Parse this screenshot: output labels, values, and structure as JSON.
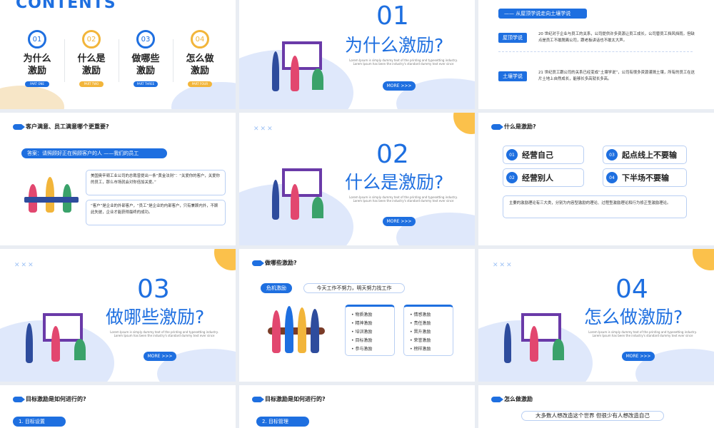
{
  "s1": {
    "title": "CONTENTS",
    "items": [
      {
        "num": "01",
        "l1": "为什么",
        "l2": "激励",
        "tag": "PART ONE",
        "color": "#1e6fe0"
      },
      {
        "num": "02",
        "l1": "什么是",
        "l2": "激励",
        "tag": "PART TWO",
        "color": "#f2b53a"
      },
      {
        "num": "03",
        "l1": "做哪些",
        "l2": "激励",
        "tag": "PART THREE",
        "color": "#1e6fe0"
      },
      {
        "num": "04",
        "l1": "怎么做",
        "l2": "激励",
        "tag": "PART FOUR",
        "color": "#f2b53a"
      }
    ]
  },
  "s2": {
    "num": "01",
    "title": "为什么激励?",
    "lorem1": "Lorem Ipsum is simply dummy text of the printing and typesetting industry.",
    "lorem2": "Lorem Ipsum has been the industry's standard dummy text ever since",
    "more": "MORE >>>"
  },
  "s3": {
    "banner": "—— 从屋顶学说走向土壤学说",
    "b1": {
      "label": "屋顶学说",
      "text": "20 世纪对于企业与员工的关系，公司提供许多资源让员工成长，公司替员工挡风挡雨，但缺点是员工不敢脱离公司，跟老板讲话也不敢太大声。"
    },
    "b2": {
      "label": "土壤学说",
      "text": "21 世纪员工跟公司的关系已经变成“土壤学说”，公司有很多资源灌溉土壤，所有的员工在这片土地上自然成长，能够长多高就长多高。"
    }
  },
  "s4": {
    "heading": "客户满意、员工满意哪个更重要?",
    "answer": "答案：请照顾好正在照顾客户的人 ——我们的员工",
    "q1": "美国奥辛顿工业公司的总裁曾提出一条“黄金法则”：“关爱你的客户，关爱你的员工，那么市场就会对你倍加关爱。”",
    "q2": "“客户”是企业的外部客户，“员工”是企业的内部客户，只有兼顾内外，不顾此失彼，企业才能获得最终的成功。"
  },
  "s5": {
    "num": "02",
    "title": "什么是激励?",
    "lorem1": "Lorem Ipsum is simply dummy text of the printing and typesetting industry.",
    "lorem2": "Lorem Ipsum has been the industry's standard dummy text ever since",
    "more": "MORE >>>",
    "x": "✕✕✕"
  },
  "s6": {
    "heading": "什么是激励?",
    "items": [
      {
        "n": "01",
        "t": "经营自己"
      },
      {
        "n": "03",
        "t": "起点线上不要输"
      },
      {
        "n": "02",
        "t": "经营别人"
      },
      {
        "n": "04",
        "t": "下半场不要输"
      }
    ],
    "note": "主要的激励理论有三大类，分别为内容型激励的理论、过程型激励理论和行为修正型激励理论。"
  },
  "s7": {
    "num": "03",
    "title": "做哪些激励?",
    "lorem1": "Lorem Ipsum is simply dummy text of the printing and typesetting industry.",
    "lorem2": "Lorem Ipsum has been the industry's standard dummy text ever since",
    "more": "MORE >>>",
    "x": "✕✕✕"
  },
  "s8": {
    "heading": "做哪些激励?",
    "pill": "危机激励",
    "slogan": "今天工作不努力，明天努力找工作",
    "list1": [
      "物质激励",
      "精神激励",
      "培训激励",
      "目标激励",
      "参与激励"
    ],
    "list2": [
      "情感激励",
      "责任激励",
      "晋升激励",
      "荣誉激励",
      "榜样激励"
    ]
  },
  "s9": {
    "num": "04",
    "title": "怎么做激励?",
    "lorem1": "Lorem Ipsum is simply dummy text of the printing and typesetting industry.",
    "lorem2": "Lorem Ipsum has been the industry's standard dummy text ever since",
    "more": "MORE >>>",
    "x": "✕✕✕"
  },
  "s10": {
    "heading": "目标激励是如何进行的?",
    "pill": "1. 目标设置"
  },
  "s11": {
    "heading": "目标激励是如何进行的?",
    "pill": "2. 目标管理"
  },
  "s12": {
    "heading": "怎么做激励",
    "slogan": "大多数人想改造这个世界  但很少有人想改造自己"
  }
}
